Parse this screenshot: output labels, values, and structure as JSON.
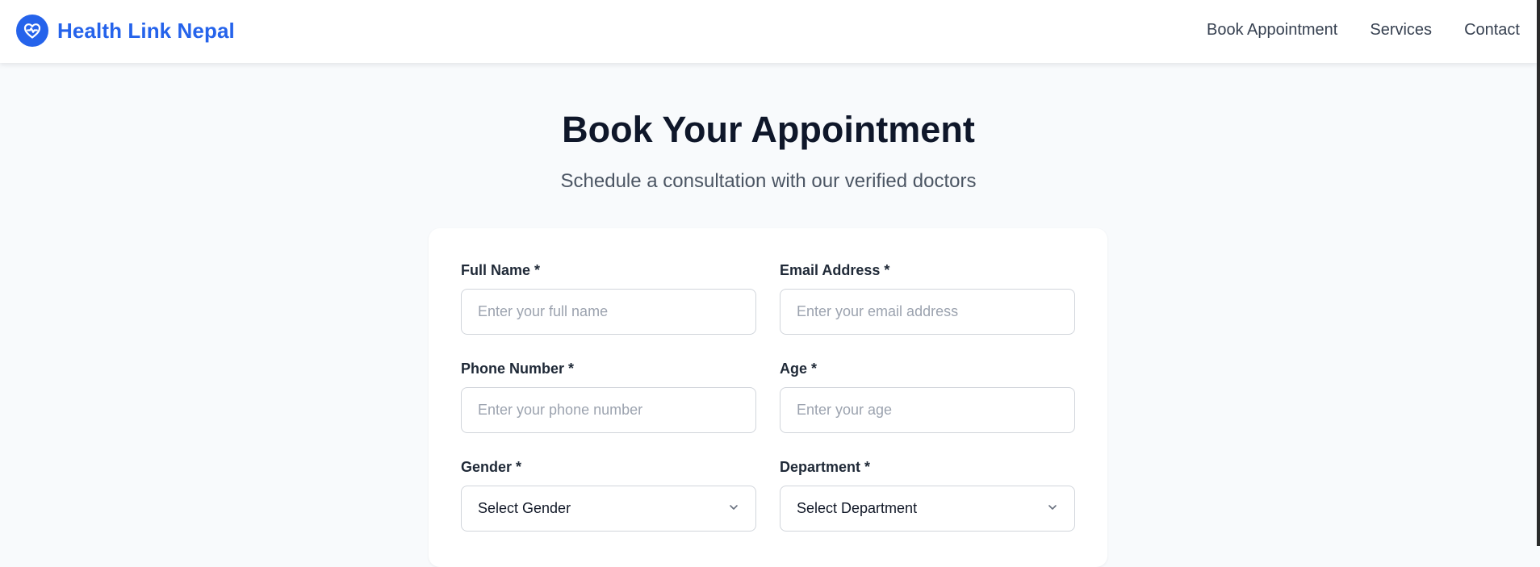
{
  "header": {
    "brand_name": "Health Link Nepal",
    "brand_icon": "heart-pulse-icon",
    "brand_color": "#2563eb",
    "nav": [
      {
        "label": "Book Appointment"
      },
      {
        "label": "Services"
      },
      {
        "label": "Contact"
      }
    ]
  },
  "hero": {
    "title": "Book Your Appointment",
    "subtitle": "Schedule a consultation with our verified doctors"
  },
  "form": {
    "full_name": {
      "label": "Full Name *",
      "placeholder": "Enter your full name",
      "value": ""
    },
    "email": {
      "label": "Email Address *",
      "placeholder": "Enter your email address",
      "value": ""
    },
    "phone": {
      "label": "Phone Number *",
      "placeholder": "Enter your phone number",
      "value": ""
    },
    "age": {
      "label": "Age *",
      "placeholder": "Enter your age",
      "value": ""
    },
    "gender": {
      "label": "Gender *",
      "selected": "Select Gender",
      "icon": "chevron-down-icon"
    },
    "department": {
      "label": "Department *",
      "selected": "Select Department",
      "icon": "chevron-down-icon"
    }
  }
}
